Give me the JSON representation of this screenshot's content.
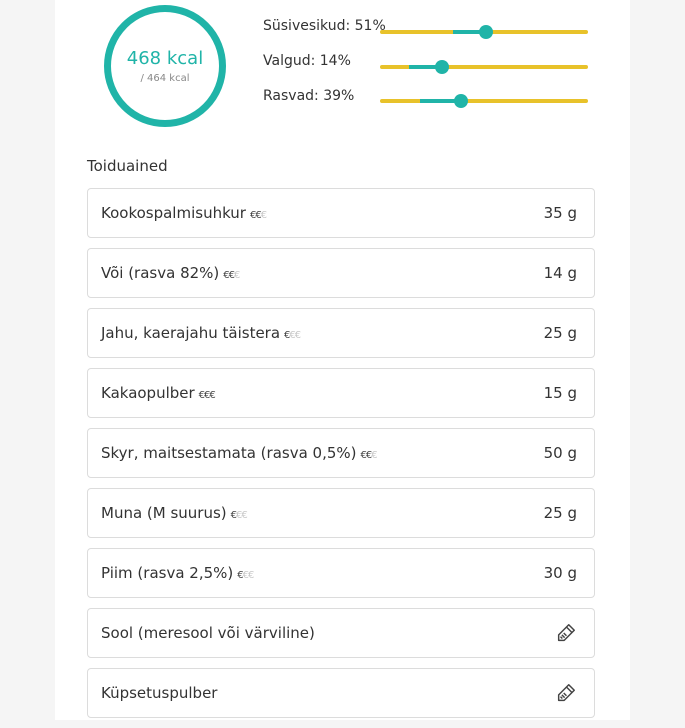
{
  "calories": {
    "value": "468 kcal",
    "target": "/ 464 kcal"
  },
  "macros": [
    {
      "label": "Süsivesikud: 51%",
      "percent": 51,
      "fill_start": 0.35,
      "knob": 0.51
    },
    {
      "label": "Valgud: 14%",
      "percent": 14,
      "fill_start": 0.14,
      "knob": 0.3
    },
    {
      "label": "Rasvad: 39%",
      "percent": 39,
      "fill_start": 0.19,
      "knob": 0.39
    }
  ],
  "ingredients_title": "Toiduained",
  "ingredients": [
    {
      "name": "Kookospalmisuhkur",
      "price_on": "€€",
      "price_off": "€",
      "amount": "35 g"
    },
    {
      "name": "Või (rasva 82%)",
      "price_on": "€€",
      "price_off": "€",
      "amount": "14 g"
    },
    {
      "name": "Jahu, kaerajahu täistera",
      "price_on": "€",
      "price_off": "€€",
      "amount": "25 g"
    },
    {
      "name": "Kakaopulber",
      "price_on": "€€€",
      "price_off": "",
      "amount": "15 g"
    },
    {
      "name": "Skyr, maitsestamata (rasva 0,5%)",
      "price_on": "€€",
      "price_off": "€",
      "amount": "50 g"
    },
    {
      "name": "Muna (M suurus)",
      "price_on": "€",
      "price_off": "€€",
      "amount": "25 g"
    },
    {
      "name": "Piim (rasva 2,5%)",
      "price_on": "€",
      "price_off": "€€",
      "amount": "30 g"
    },
    {
      "name": "Sool (meresool või värviline)",
      "price_on": "",
      "price_off": "",
      "amount": "",
      "icon": "pencil-icon"
    },
    {
      "name": "Küpsetuspulber",
      "price_on": "",
      "price_off": "",
      "amount": "",
      "icon": "pencil-icon"
    }
  ],
  "colors": {
    "teal": "#20b4a8",
    "yellow": "#e8c22a"
  }
}
